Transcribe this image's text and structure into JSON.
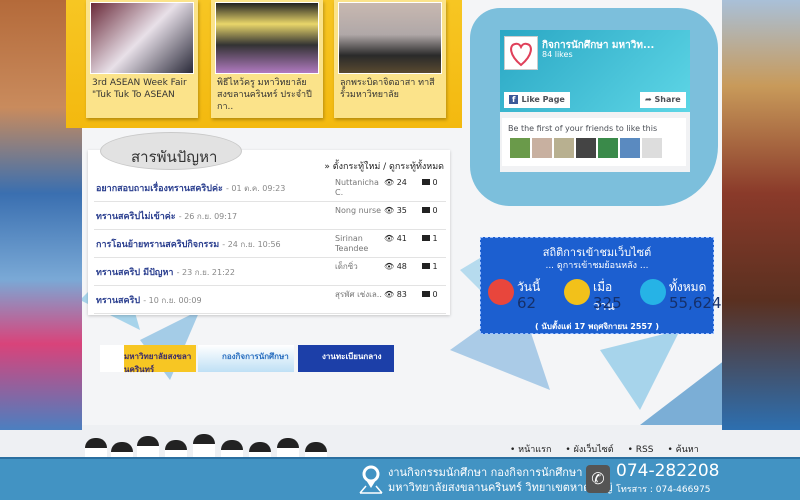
{
  "news": [
    {
      "caption": "3rd ASEAN Week Fair \"Tuk Tuk To ASEAN"
    },
    {
      "caption": "พิธีไหว้ครู มหาวิทยาลัยสงขลานครินทร์ ประจำปีกา.."
    },
    {
      "caption": "ลูกพระบิดาจิตอาสา ทาสีรั้วมหาวิทยาลัย"
    }
  ],
  "forum": {
    "title": "สารพันปัญหา",
    "links": "» ตั้งกระทู้ใหม่ / ดูกระทู้ทั้งหมด",
    "rows": [
      {
        "title": "อยากสอบถามเรื่องทรานสคริปค่ะ",
        "date": "- 01 ต.ค. 09:23",
        "author": "Nuttanicha C.",
        "views": "24",
        "comments": "0"
      },
      {
        "title": "ทรานสคริปไม่เข้าค่ะ",
        "date": "- 26 ก.ย. 09:17",
        "author": "Nong nurse",
        "views": "35",
        "comments": "0"
      },
      {
        "title": "การโอนย้ายทรานสคริปกิจกรรม",
        "date": "- 24 ก.ย. 10:56",
        "author": "Sirinan Teandee",
        "views": "41",
        "comments": "1"
      },
      {
        "title": "ทรานสคริป มีปัญหา",
        "date": "- 23 ก.ย. 21:22",
        "author": "เด็กซิ่ว",
        "views": "48",
        "comments": "1"
      },
      {
        "title": "ทรานสคริป",
        "date": "- 10 ก.ย. 00:09",
        "author": "สุรพัศ เช่งเล..",
        "views": "83",
        "comments": "0"
      }
    ]
  },
  "facebook": {
    "page_name": "กิจการนักศึกษา มหาวิท...",
    "likes": "84 likes",
    "like_button": "Like Page",
    "share_button": "Share",
    "friends_text": "Be the first of your friends to like this"
  },
  "stats": {
    "title": "สถิติการเข้าชมเว็บไซต์",
    "history_link": "... ดูการเข้าชมย้อนหลัง ...",
    "items": [
      {
        "label": "วันนี้",
        "value": "62",
        "color": "#e8463c"
      },
      {
        "label": "เมื่อวาน",
        "value": "325",
        "color": "#f2c11a"
      },
      {
        "label": "ทั้งหมด",
        "value": "55,624",
        "color": "#26b3e6"
      }
    ],
    "since": "( นับตั้งแต่ 17 พฤศจิกายน 2557 )"
  },
  "banners": [
    "มหาวิทยาลัยสงขลานครินทร์",
    "กองกิจการนักศึกษา",
    "งานทะเบียนกลาง"
  ],
  "footer_nav": [
    "• หน้าแรก",
    "• ผังเว็บไซต์",
    "• RSS",
    "• ค้นหา"
  ],
  "footer": {
    "address_line1": "งานกิจกรรมนักศึกษา กองกิจการนักศึกษา",
    "address_line2": "มหาวิทยาลัยสงขลานครินทร์ วิทยาเขตหาดใหญ่",
    "phone": "074-282208",
    "fax": "โทรสาร : 074-466975"
  }
}
